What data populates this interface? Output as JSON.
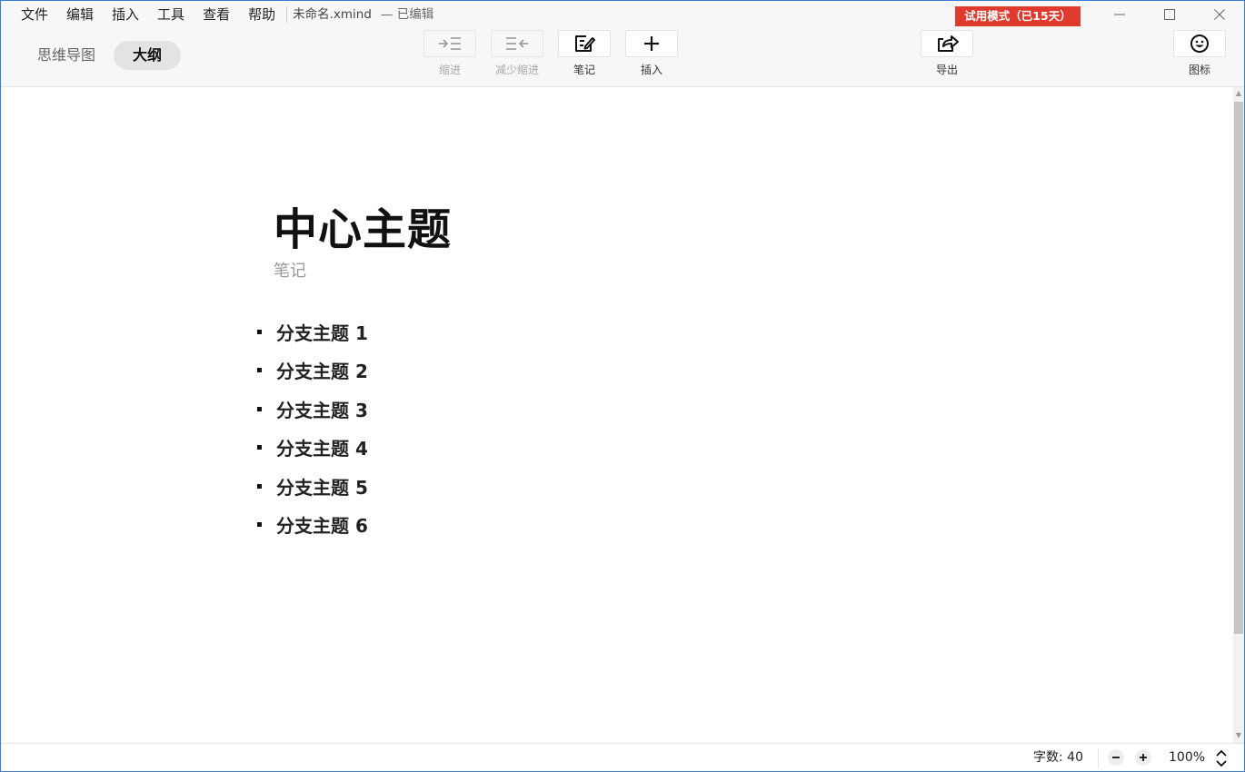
{
  "menu": {
    "items": [
      "文件",
      "编辑",
      "插入",
      "工具",
      "查看",
      "帮助"
    ]
  },
  "document": {
    "title": "未命名.xmind",
    "status": "— 已编辑"
  },
  "trial_badge": "试用模式（已15天）",
  "view_tabs": {
    "mindmap": "思维导图",
    "outline": "大纲",
    "active": "outline"
  },
  "toolbar": {
    "indent": "缩进",
    "outdent": "减少缩进",
    "note": "笔记",
    "insert": "插入",
    "export": "导出",
    "icon": "图标"
  },
  "outline": {
    "central_topic": "中心主题",
    "note_placeholder": "笔记",
    "branches": [
      "分支主题 1",
      "分支主题 2",
      "分支主题 3",
      "分支主题 4",
      "分支主题 5",
      "分支主题 6"
    ]
  },
  "status": {
    "word_count": "字数: 40",
    "zoom": "100%"
  },
  "colors": {
    "trial_badge_bg": "#e03a2f",
    "window_border": "#3a7bd5"
  }
}
